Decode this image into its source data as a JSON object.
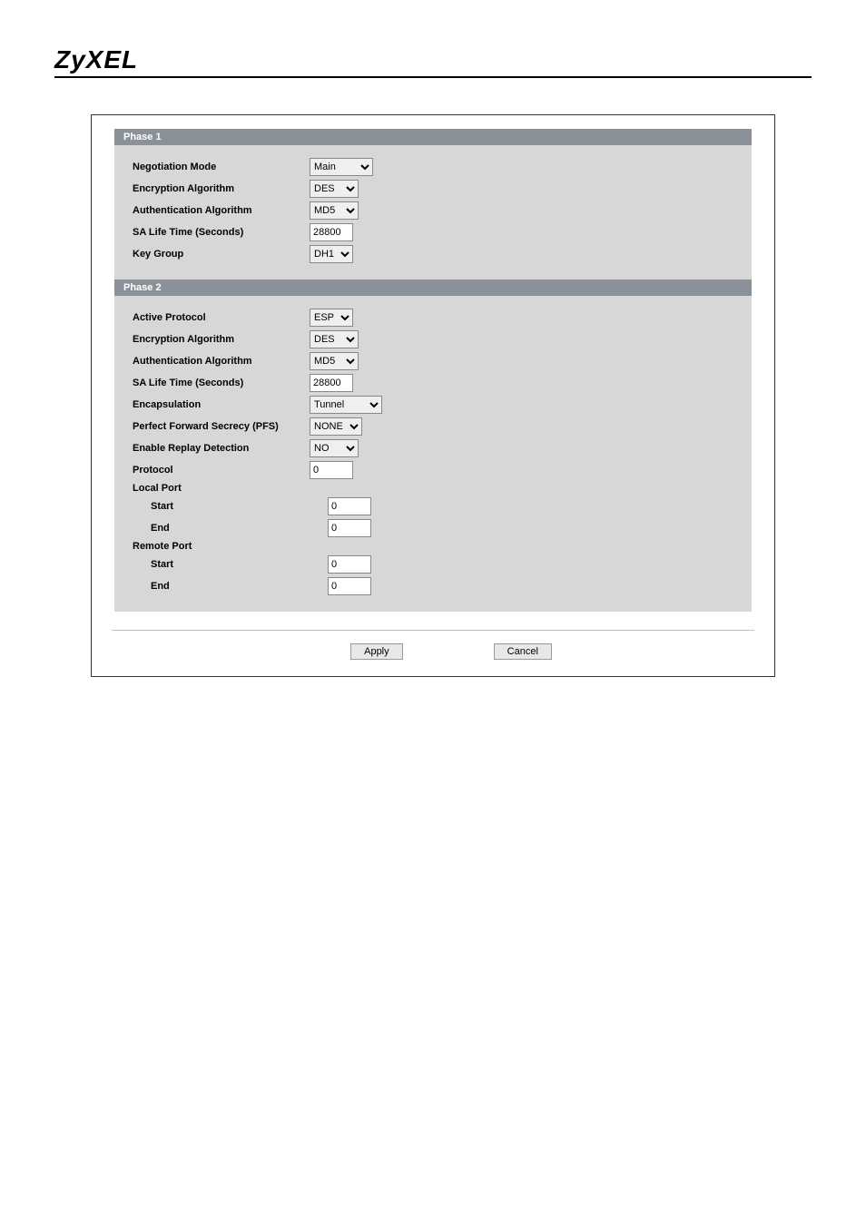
{
  "brand": "ZyXEL",
  "phase1": {
    "title": "Phase 1",
    "negotiation_mode": {
      "label": "Negotiation Mode",
      "value": "Main"
    },
    "encryption": {
      "label": "Encryption Algorithm",
      "value": "DES"
    },
    "auth": {
      "label": "Authentication Algorithm",
      "value": "MD5"
    },
    "sa_life": {
      "label": "SA Life Time (Seconds)",
      "value": "28800"
    },
    "key_group": {
      "label": "Key Group",
      "value": "DH1"
    }
  },
  "phase2": {
    "title": "Phase 2",
    "active_protocol": {
      "label": "Active Protocol",
      "value": "ESP"
    },
    "encryption": {
      "label": "Encryption Algorithm",
      "value": "DES"
    },
    "auth": {
      "label": "Authentication Algorithm",
      "value": "MD5"
    },
    "sa_life": {
      "label": "SA Life Time (Seconds)",
      "value": "28800"
    },
    "encapsulation": {
      "label": "Encapsulation",
      "value": "Tunnel"
    },
    "pfs": {
      "label": "Perfect Forward Secrecy (PFS)",
      "value": "NONE"
    },
    "replay": {
      "label": "Enable Replay Detection",
      "value": "NO"
    },
    "protocol": {
      "label": "Protocol",
      "value": "0"
    },
    "local_port": {
      "label": "Local Port",
      "start": {
        "label": "Start",
        "value": "0"
      },
      "end": {
        "label": "End",
        "value": "0"
      }
    },
    "remote_port": {
      "label": "Remote Port",
      "start": {
        "label": "Start",
        "value": "0"
      },
      "end": {
        "label": "End",
        "value": "0"
      }
    }
  },
  "buttons": {
    "apply": "Apply",
    "cancel": "Cancel"
  }
}
